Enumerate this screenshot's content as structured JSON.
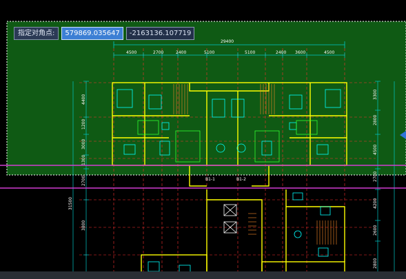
{
  "prompt": {
    "label": "指定对角点:",
    "x_value": "579869.035647",
    "y_value": "-2163136.107719"
  },
  "dimensions": {
    "overall": "29400",
    "top_chain": [
      "4500",
      "2700",
      "2400",
      "5100",
      "5100",
      "2400",
      "3600",
      "4500"
    ],
    "left_chain": [
      "4400",
      "1200",
      "3000",
      "1300",
      "2700",
      "31500",
      "3800"
    ],
    "right_chain": [
      "3300",
      "2800",
      "4500",
      "2700",
      "4200",
      "2600",
      "2800"
    ]
  },
  "room_tags": [
    "B1-1",
    "B1-2"
  ],
  "colors": {
    "selection_fill": "#0f5a14",
    "wall": "#ffff00",
    "dim_line": "#00c8c8",
    "axis_line": "#ff3030",
    "magenta": "#d23cd2",
    "furniture": "#00ffff"
  }
}
